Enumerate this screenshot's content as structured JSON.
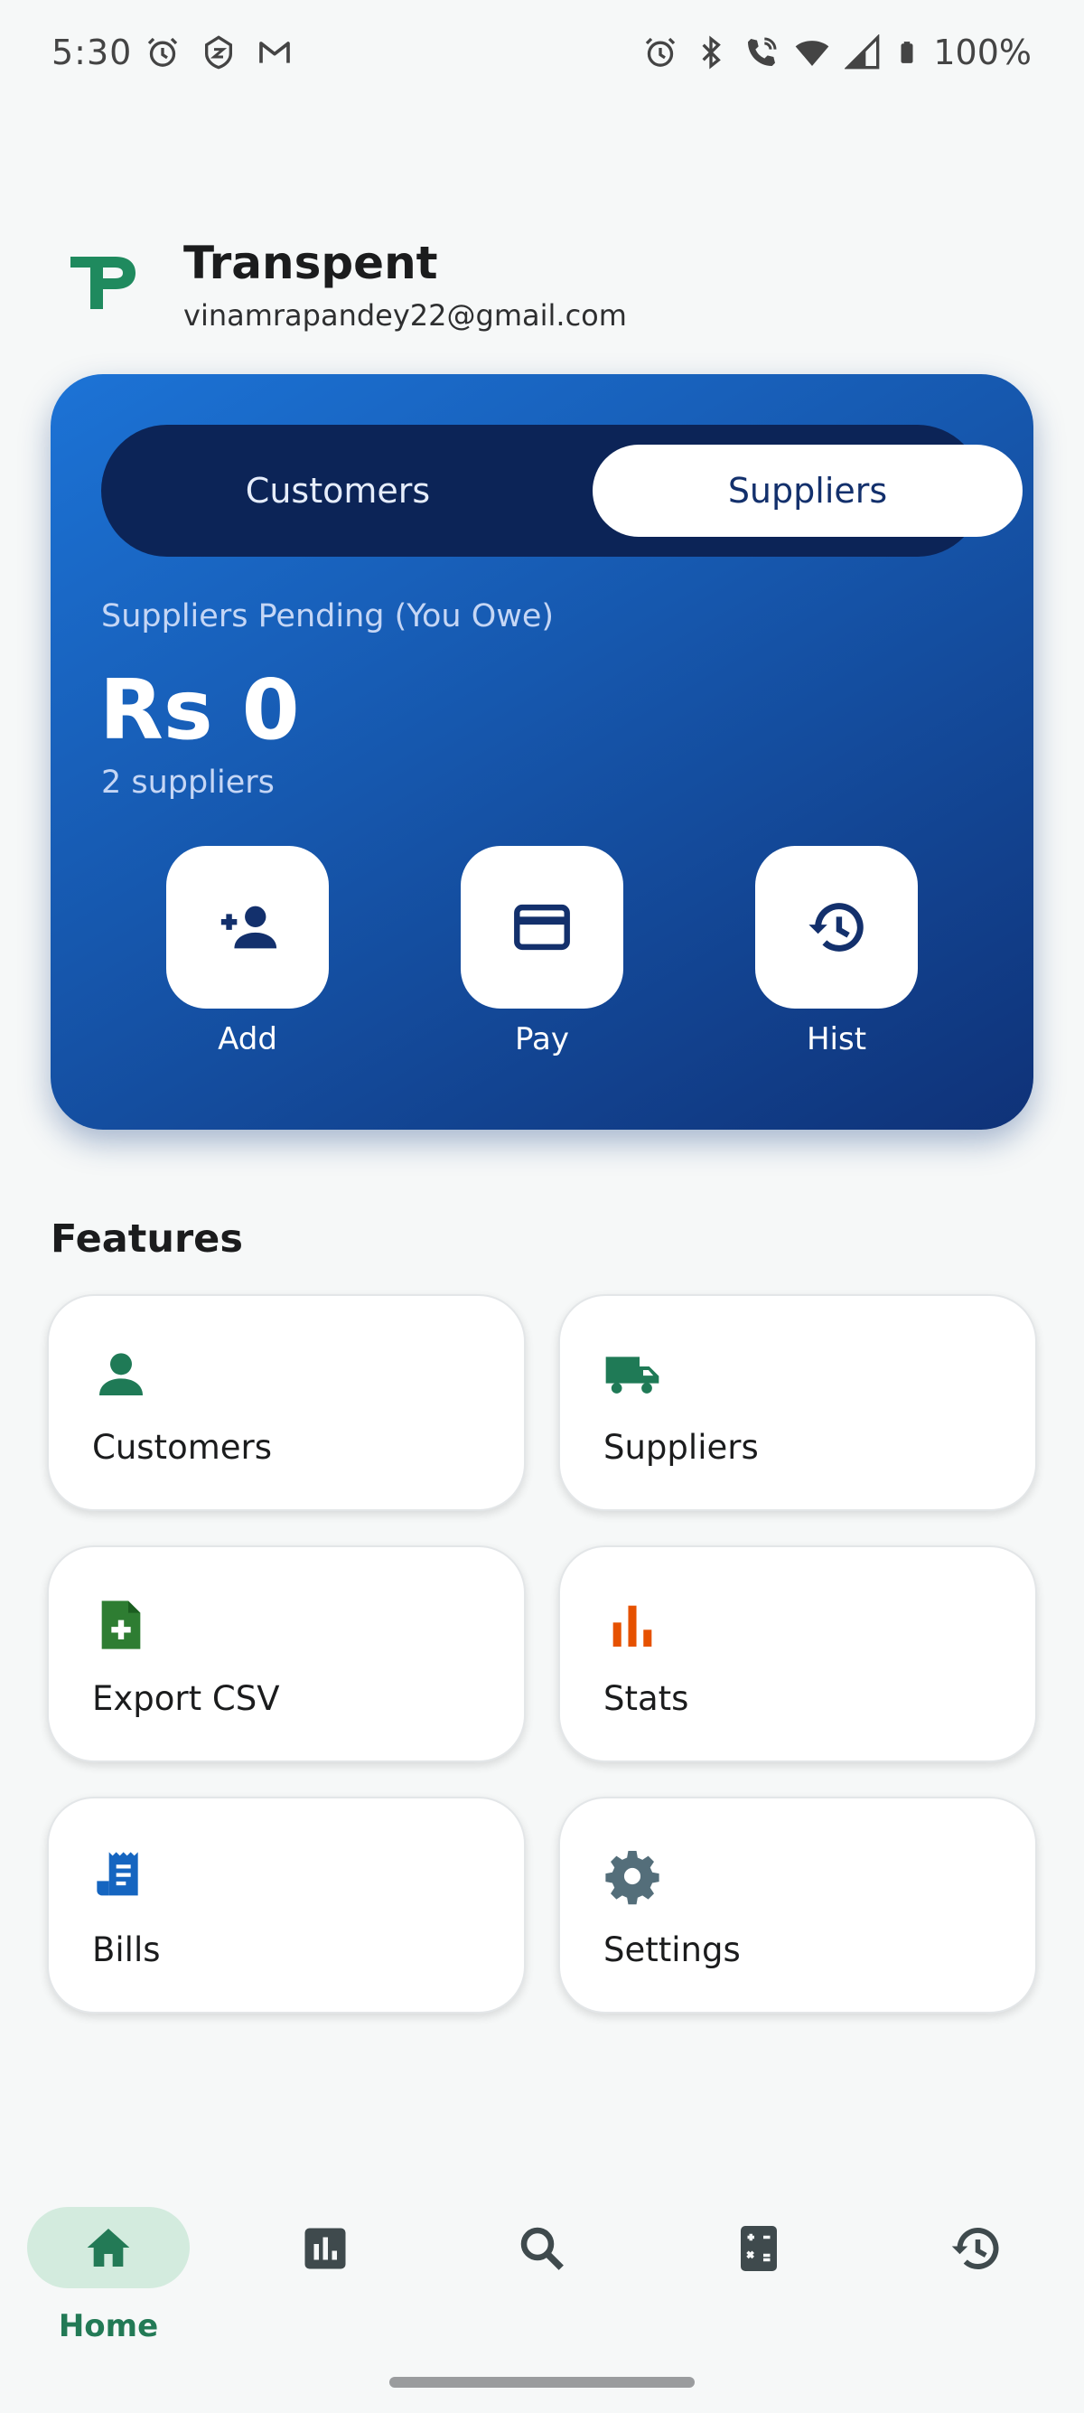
{
  "status_bar": {
    "time": "5:30",
    "battery": "100%"
  },
  "header": {
    "app_name": "Transpent",
    "email": "vinamrapandey22@gmail.com",
    "logo_icon": "transpent-logo-icon"
  },
  "balance_card": {
    "tabs": [
      {
        "label": "Customers",
        "selected": false
      },
      {
        "label": "Suppliers",
        "selected": true
      }
    ],
    "pending_label": "Suppliers Pending (You Owe)",
    "amount": "Rs 0",
    "count": "2 suppliers",
    "actions": [
      {
        "label": "Add",
        "icon": "add-person-icon"
      },
      {
        "label": "Pay",
        "icon": "card-icon"
      },
      {
        "label": "Hist",
        "icon": "history-icon"
      }
    ]
  },
  "features": {
    "heading": "Features",
    "items": [
      {
        "label": "Customers",
        "icon": "person-icon",
        "color": "#1f7a56"
      },
      {
        "label": "Suppliers",
        "icon": "truck-icon",
        "color": "#1f7a56"
      },
      {
        "label": "Export CSV",
        "icon": "file-add-icon",
        "color": "#2e7d32"
      },
      {
        "label": "Stats",
        "icon": "bar-chart-icon",
        "color": "#e65100"
      },
      {
        "label": "Bills",
        "icon": "receipt-icon",
        "color": "#1565c0"
      },
      {
        "label": "Settings",
        "icon": "gear-icon",
        "color": "#546e7a"
      }
    ]
  },
  "bottom_nav": {
    "items": [
      {
        "label": "Home",
        "icon": "home-icon",
        "active": true
      },
      {
        "label": "",
        "icon": "stats-icon",
        "active": false
      },
      {
        "label": "",
        "icon": "search-icon",
        "active": false
      },
      {
        "label": "",
        "icon": "calculator-icon",
        "active": false
      },
      {
        "label": "",
        "icon": "history-icon",
        "active": false
      }
    ]
  },
  "colors": {
    "accent_green": "#237a56",
    "card_blue": "#1657ad",
    "card_dark": "#0c2457"
  }
}
